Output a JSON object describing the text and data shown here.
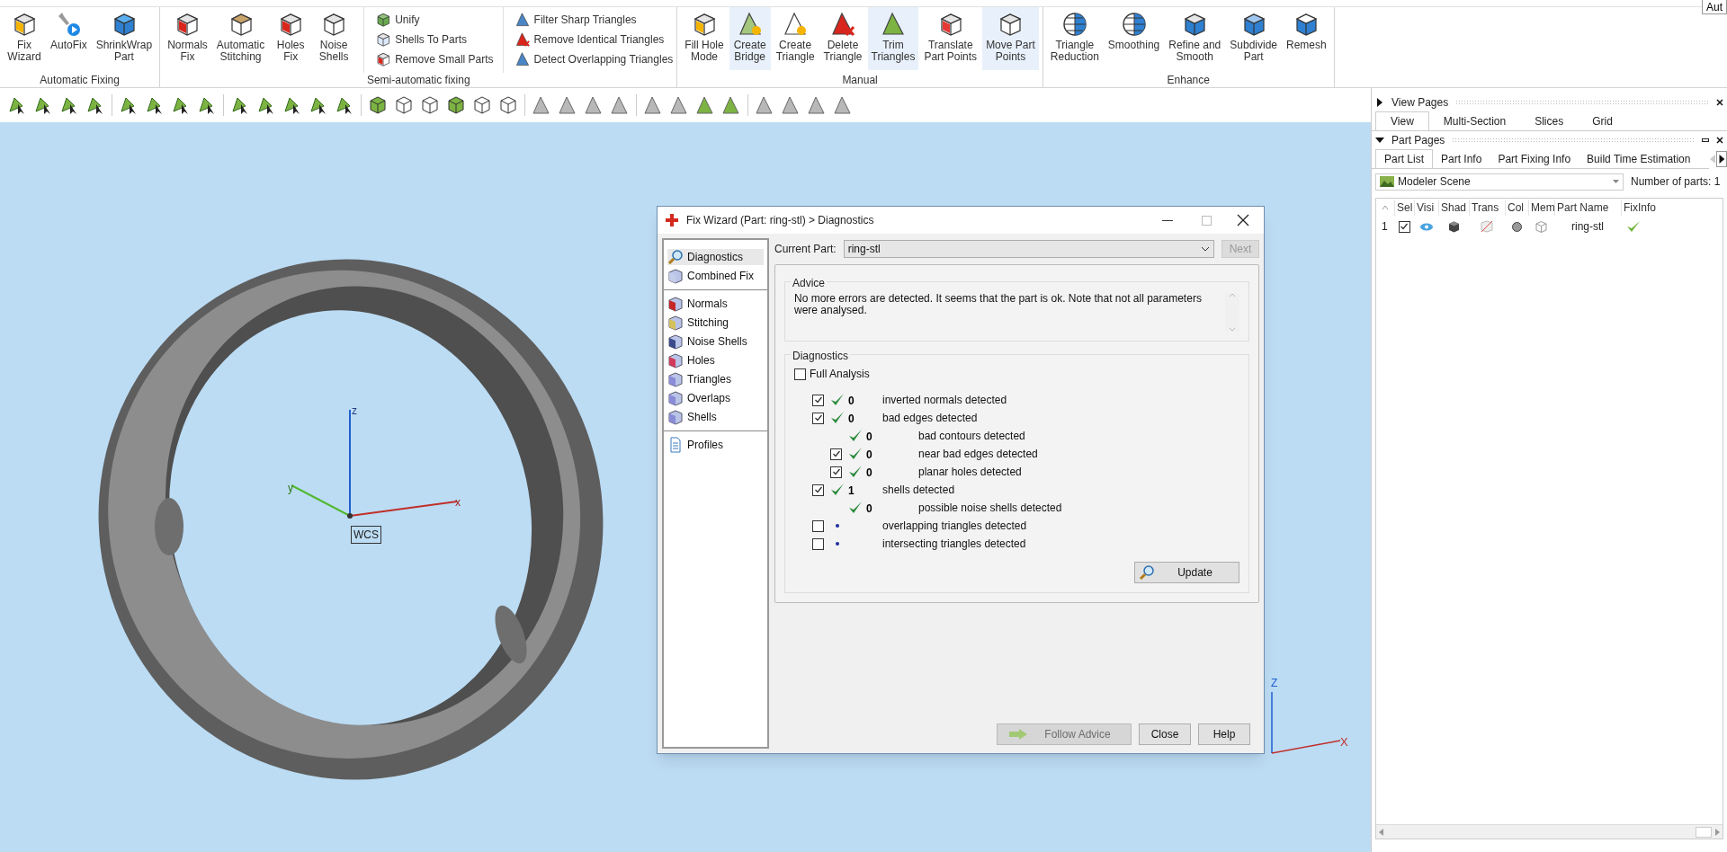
{
  "corner_button": "Aut",
  "ribbon": {
    "groups": [
      {
        "label": "Automatic Fixing",
        "buttons": [
          {
            "label": "Fix\nWizard",
            "selected": false
          },
          {
            "label": "AutoFix",
            "selected": false
          },
          {
            "label": "ShrinkWrap\nPart",
            "selected": false
          }
        ]
      },
      {
        "label": "Semi-automatic fixing",
        "buttons": [
          {
            "label": "Normals\nFix",
            "selected": false
          },
          {
            "label": "Automatic\nStitching",
            "selected": false
          },
          {
            "label": "Holes\nFix",
            "selected": false
          },
          {
            "label": "Noise\nShells",
            "selected": false
          }
        ],
        "lists": [
          [
            "Unify",
            "Shells To Parts",
            "Remove Small Parts"
          ],
          [
            "Filter Sharp Triangles",
            "Remove Identical Triangles",
            "Detect Overlapping Triangles"
          ]
        ]
      },
      {
        "label": "Manual",
        "buttons": [
          {
            "label": "Fill Hole\nMode",
            "selected": false
          },
          {
            "label": "Create\nBridge",
            "selected": true
          },
          {
            "label": "Create\nTriangle",
            "selected": false
          },
          {
            "label": "Delete\nTriangle",
            "selected": false
          },
          {
            "label": "Trim\nTriangles",
            "selected": true
          },
          {
            "label": "Translate\nPart Points",
            "selected": false
          },
          {
            "label": "Move Part\nPoints",
            "selected": true
          }
        ]
      },
      {
        "label": "Enhance",
        "buttons": [
          {
            "label": "Triangle\nReduction",
            "selected": false
          },
          {
            "label": "Smoothing",
            "selected": false
          },
          {
            "label": "Refine and\nSmooth",
            "selected": false
          },
          {
            "label": "Subdivide\nPart",
            "selected": false
          },
          {
            "label": "Remesh",
            "selected": false
          }
        ]
      }
    ]
  },
  "viewport": {
    "axis_labels": {
      "z": "z",
      "y": "y",
      "x": "x"
    },
    "wcs_label": "WCS",
    "corner_axis_labels": {
      "z": "Z",
      "x": "X"
    }
  },
  "dialog": {
    "title": "Fix Wizard (Part: ring-stl) > Diagnostics",
    "nav": [
      [
        {
          "label": "Diagnostics",
          "selected": true
        },
        {
          "label": "Combined Fix",
          "selected": false
        }
      ],
      [
        {
          "label": "Normals",
          "selected": false
        },
        {
          "label": "Stitching",
          "selected": false
        },
        {
          "label": "Noise Shells",
          "selected": false
        },
        {
          "label": "Holes",
          "selected": false
        },
        {
          "label": "Triangles",
          "selected": false
        },
        {
          "label": "Overlaps",
          "selected": false
        },
        {
          "label": "Shells",
          "selected": false
        }
      ],
      [
        {
          "label": "Profiles",
          "selected": false
        }
      ]
    ],
    "current_part_label": "Current Part:",
    "current_part": "ring-stl",
    "next_button": {
      "label": "Next",
      "disabled": true
    },
    "advice": {
      "title": "Advice",
      "text": "No more errors are detected. It seems that the part is ok. Note that not all parameters were analysed."
    },
    "diagnostics": {
      "title": "Diagnostics",
      "full_analysis": {
        "label": "Full Analysis",
        "checked": false
      },
      "rows": [
        {
          "kind": "check",
          "checked": true,
          "passed": true,
          "count": "0",
          "label": "inverted normals detected"
        },
        {
          "kind": "check",
          "checked": true,
          "passed": true,
          "count": "0",
          "label": "bad edges detected",
          "children": [
            {
              "kind": "plain",
              "passed": true,
              "count": "0",
              "label": "bad contours detected"
            },
            {
              "kind": "check",
              "checked": true,
              "passed": true,
              "count": "0",
              "label": "near bad edges detected"
            },
            {
              "kind": "check",
              "checked": true,
              "passed": true,
              "count": "0",
              "label": "planar holes detected"
            }
          ]
        },
        {
          "kind": "check",
          "checked": true,
          "passed": true,
          "count": "1",
          "label": "shells detected",
          "children": [
            {
              "kind": "plain",
              "passed": true,
              "count": "0",
              "label": "possible noise shells detected"
            }
          ]
        },
        {
          "kind": "check",
          "checked": false,
          "passed": false,
          "label": "overlapping triangles detected"
        },
        {
          "kind": "check",
          "checked": false,
          "passed": false,
          "label": "intersecting triangles detected"
        }
      ],
      "update_button": "Update"
    },
    "buttons": [
      {
        "label": "Follow Advice",
        "disabled": true
      },
      {
        "label": "Close",
        "disabled": false
      },
      {
        "label": "Help",
        "disabled": false
      }
    ]
  },
  "side_panel": {
    "view_pages": {
      "title": "View Pages",
      "expanded": false,
      "tabs": [
        {
          "label": "View",
          "selected": true
        },
        {
          "label": "Multi-Section",
          "selected": false
        },
        {
          "label": "Slices",
          "selected": false
        },
        {
          "label": "Grid",
          "selected": false
        }
      ]
    },
    "part_pages": {
      "title": "Part Pages",
      "expanded": true,
      "tabs": [
        {
          "label": "Part List",
          "selected": true
        },
        {
          "label": "Part Info",
          "selected": false
        },
        {
          "label": "Part Fixing Info",
          "selected": false
        },
        {
          "label": "Build Time Estimation",
          "selected": false
        }
      ],
      "scene": "Modeler Scene",
      "part_count": "Number of parts: 1",
      "table": {
        "columns": [
          "Sel",
          "Visi",
          "Shad",
          "Trans",
          "Col",
          "Mem",
          "Part Name",
          "FixInfo"
        ],
        "rows": [
          {
            "index": "1",
            "selected": true,
            "name": "ring-stl",
            "fix_ok": true
          }
        ]
      }
    }
  }
}
